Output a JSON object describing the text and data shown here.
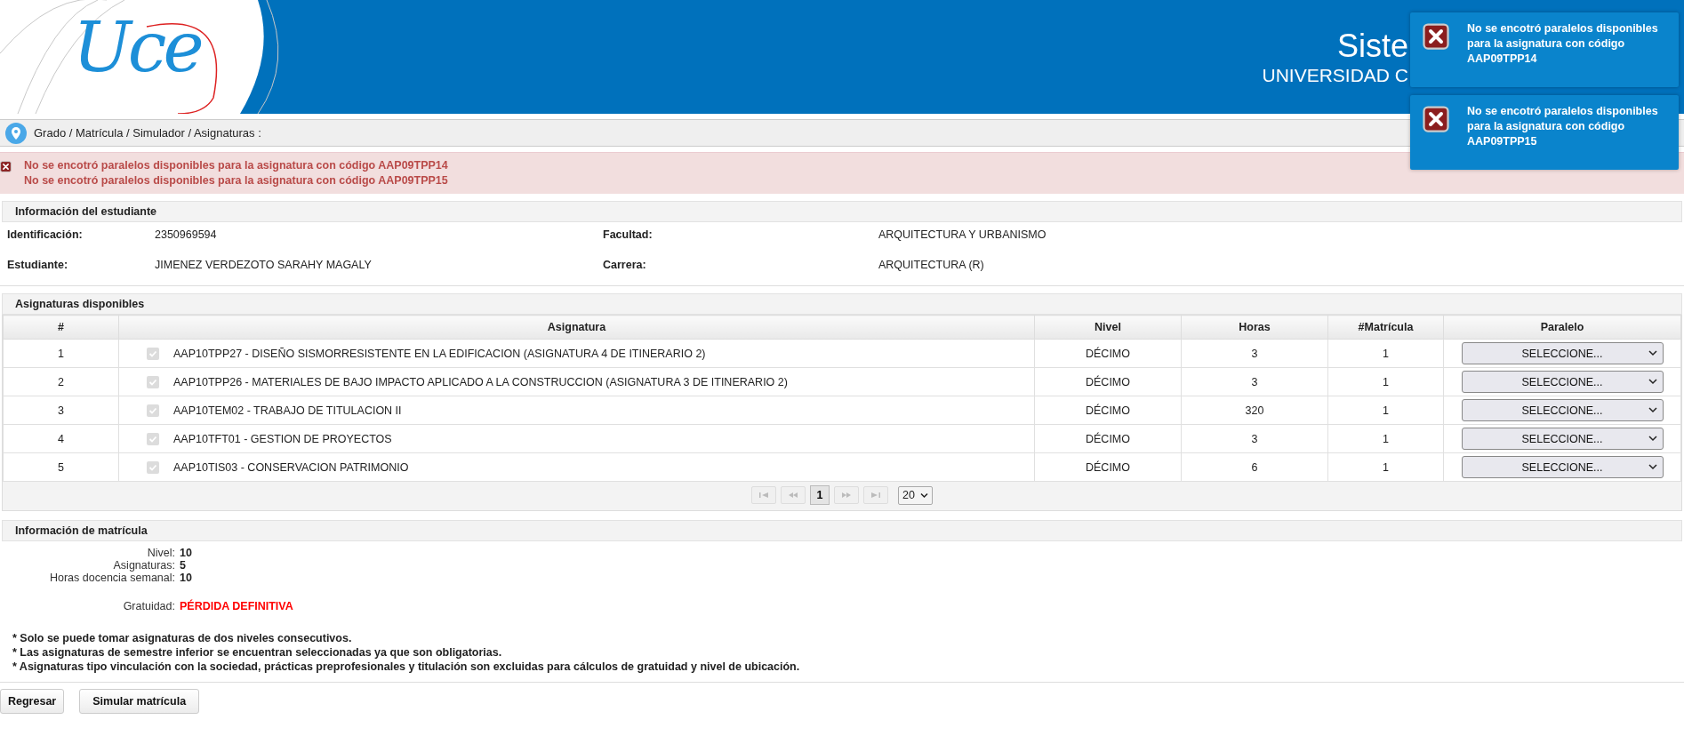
{
  "header": {
    "logo_text": "Uce",
    "title": "Siste",
    "subtitle": "UNIVERSIDAD C"
  },
  "breadcrumb": "Grado / Matrícula / Simulador / Asignaturas :",
  "alert_messages": [
    "No se encotró paralelos disponibles para la asignatura con código AAP09TPP14",
    "No se encotró paralelos disponibles para la asignatura con código AAP09TPP15"
  ],
  "student_info": {
    "title": "Información del estudiante",
    "fields": [
      {
        "label": "Identificación:",
        "value": "2350969594"
      },
      {
        "label": "Facultad:",
        "value": "ARQUITECTURA Y URBANISMO"
      },
      {
        "label": "Estudiante:",
        "value": "JIMENEZ VERDEZOTO SARAHY MAGALY"
      },
      {
        "label": "Carrera:",
        "value": "ARQUITECTURA (R)"
      }
    ]
  },
  "subjects": {
    "title": "Asignaturas disponibles",
    "columns": [
      "#",
      "Asignatura",
      "Nivel",
      "Horas",
      "#Matrícula",
      "Paralelo"
    ],
    "rows": [
      {
        "number": "1",
        "checked": true,
        "disabled": true,
        "name": "AAP10TPP27 - DISEÑO SISMORRESISTENTE EN LA EDIFICACION (ASIGNATURA 4 DE ITINERARIO 2)",
        "level": "DÉCIMO",
        "hours": "3",
        "enrollment": "1",
        "parallel": "SELECCIONE..."
      },
      {
        "number": "2",
        "checked": true,
        "disabled": true,
        "name": "AAP10TPP26 - MATERIALES DE BAJO IMPACTO APLICADO A LA CONSTRUCCION (ASIGNATURA 3 DE ITINERARIO 2)",
        "level": "DÉCIMO",
        "hours": "3",
        "enrollment": "1",
        "parallel": "SELECCIONE..."
      },
      {
        "number": "3",
        "checked": true,
        "disabled": true,
        "name": "AAP10TEM02 - TRABAJO DE TITULACION II",
        "level": "DÉCIMO",
        "hours": "320",
        "enrollment": "1",
        "parallel": "SELECCIONE..."
      },
      {
        "number": "4",
        "checked": true,
        "disabled": true,
        "name": "AAP10TFT01 - GESTION DE PROYECTOS",
        "level": "DÉCIMO",
        "hours": "3",
        "enrollment": "1",
        "parallel": "SELECCIONE..."
      },
      {
        "number": "5",
        "checked": true,
        "disabled": true,
        "name": "AAP10TIS03 - CONSERVACION PATRIMONIO",
        "level": "DÉCIMO",
        "hours": "6",
        "enrollment": "1",
        "parallel": "SELECCIONE..."
      }
    ],
    "pagination": {
      "current_page": "1",
      "page_size": "20"
    }
  },
  "enrollment_info": {
    "title": "Información de matrícula",
    "fields": [
      {
        "label": "Nivel:",
        "value": "10",
        "kind": "normal"
      },
      {
        "label": "Asignaturas:",
        "value": "5",
        "kind": "normal"
      },
      {
        "label": "Horas docencia semanal:",
        "value": "10",
        "kind": "normal"
      },
      {
        "label": "Gratuidad:",
        "value": "PÉRDIDA DEFINITIVA",
        "kind": "warning"
      }
    ]
  },
  "notes": [
    "* Solo se puede tomar asignaturas de dos niveles consecutivos.",
    "* Las asignaturas de semestre inferior se encuentran seleccionadas ya que son obligatorias.",
    "* Asignaturas tipo vinculación con la sociedad, prácticas preprofesionales y titulación son excluidas para cálculos de gratuidad y nivel de ubicación."
  ],
  "buttons": [
    "Regresar",
    "Simular matrícula"
  ],
  "toasts": [
    "No se encotró paralelos disponibles para la asignatura con código AAP09TPP14",
    "No se encotró paralelos disponibles para la asignatura con código AAP09TPP15"
  ]
}
